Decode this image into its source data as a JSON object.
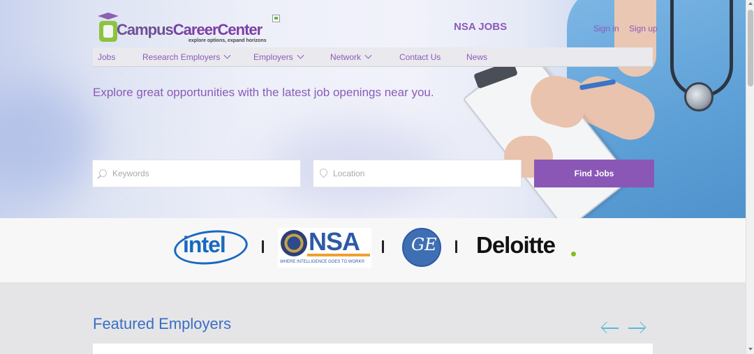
{
  "header": {
    "logo_text_part1": "Campus",
    "logo_text_part2": "CareerCenter",
    "logo_tagline": "explore options, expand horizons",
    "site_title": "NSA JOBS",
    "sign_in": "Sign in",
    "sign_up": "Sign up"
  },
  "nav": {
    "items": [
      {
        "label": "Jobs",
        "has_dropdown": false
      },
      {
        "label": "Research Employers",
        "has_dropdown": true
      },
      {
        "label": "Employers",
        "has_dropdown": true
      },
      {
        "label": "Network",
        "has_dropdown": true
      },
      {
        "label": "Contact Us",
        "has_dropdown": false
      },
      {
        "label": "News",
        "has_dropdown": false
      }
    ]
  },
  "hero": {
    "tagline": "Explore great opportunities with the latest job openings near you."
  },
  "search": {
    "keywords_placeholder": "Keywords",
    "keywords_value": "",
    "location_placeholder": "Location",
    "location_value": "",
    "find_button": "Find Jobs"
  },
  "partner_logos": {
    "intel": "intel",
    "nsa": "NSA",
    "nsa_tagline": "WHERE INTELLIGENCE GOES TO WORK®",
    "ge": "GE",
    "deloitte": "Deloitte"
  },
  "featured": {
    "title": "Featured Employers"
  },
  "colors": {
    "brand_purple": "#8a57b7",
    "heading_blue": "#3a6fc2",
    "arrow_teal": "#5bb9d6",
    "deloitte_green": "#86bc25"
  }
}
